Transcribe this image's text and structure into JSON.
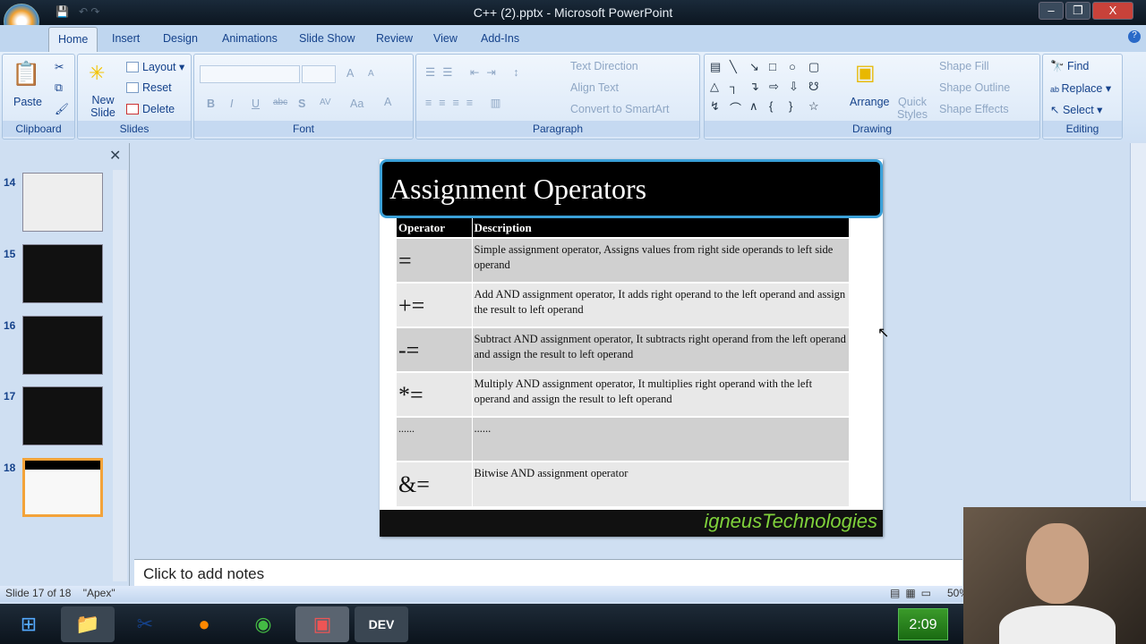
{
  "window": {
    "title": "C++ (2).pptx - Microsoft PowerPoint",
    "min": "–",
    "max": "❐",
    "close": "X"
  },
  "tabs": [
    "Home",
    "Insert",
    "Design",
    "Animations",
    "Slide Show",
    "Review",
    "View",
    "Add-Ins"
  ],
  "ribbon": {
    "clipboard": {
      "label": "Clipboard",
      "paste": "Paste"
    },
    "slides": {
      "label": "Slides",
      "new_slide": "New Slide",
      "layout": "Layout",
      "reset": "Reset",
      "delete": "Delete"
    },
    "font": {
      "label": "Font",
      "bold": "B",
      "italic": "I",
      "underline": "U",
      "strike": "abc",
      "shadow": "S",
      "spacing": "AV",
      "case": "Aa",
      "color": "A",
      "grow": "A",
      "shrink": "A"
    },
    "paragraph": {
      "label": "Paragraph",
      "text_direction": "Text Direction",
      "align_text": "Align Text",
      "convert": "Convert to SmartArt"
    },
    "drawing": {
      "label": "Drawing",
      "arrange": "Arrange",
      "quick_styles": "Quick Styles",
      "shape_fill": "Shape Fill",
      "shape_outline": "Shape Outline",
      "shape_effects": "Shape Effects",
      "shapes": [
        "▤",
        "╲",
        "↘",
        "□",
        "○",
        "▢",
        "△",
        "┐",
        "↴",
        "⇨",
        "⇩",
        "☋",
        "↯",
        "⌒",
        "∧",
        "{",
        "}",
        "☆"
      ]
    },
    "editing": {
      "label": "Editing",
      "find": "Find",
      "replace": "Replace",
      "select": "Select"
    }
  },
  "thumbnails": [
    {
      "num": "14"
    },
    {
      "num": "15"
    },
    {
      "num": "16"
    },
    {
      "num": "17"
    },
    {
      "num": "18"
    }
  ],
  "slide": {
    "title": "Assignment Operators",
    "headers": [
      "Operator",
      "Description"
    ],
    "rows": [
      {
        "op": "=",
        "desc": "Simple assignment operator, Assigns values from right side operands to left side operand"
      },
      {
        "op": "+=",
        "desc": "Add AND assignment operator, It adds right operand to the left operand and assign the result to left operand"
      },
      {
        "op": "-=",
        "desc": "Subtract AND assignment operator, It subtracts right operand from the left operand and assign the result to left operand"
      },
      {
        "op": "*=",
        "desc": "Multiply AND assignment operator, It multiplies right operand with the left operand and assign the result to left operand"
      },
      {
        "op": "......",
        "desc": "......"
      },
      {
        "op": "&=",
        "desc": "Bitwise AND assignment operator"
      }
    ],
    "footer_logo": "igneusTechnologies"
  },
  "notes": {
    "placeholder": "Click to add notes"
  },
  "status": {
    "slide": "Slide 17 of 18",
    "theme": "\"Apex\"",
    "zoom": "50%"
  },
  "taskbar": {
    "clock": "2:09",
    "dev": "DEV"
  }
}
